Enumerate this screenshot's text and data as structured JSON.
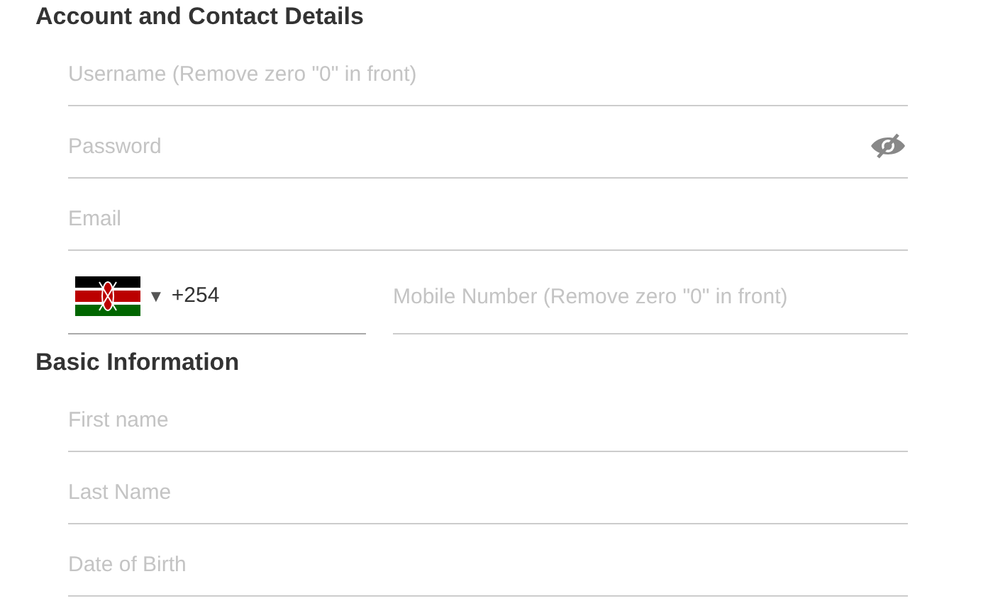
{
  "sections": [
    {
      "title": "Account and Contact Details",
      "fields": [
        {
          "kind": "text",
          "placeholder": "Username (Remove zero \"0\" in front)"
        },
        {
          "kind": "password",
          "placeholder": "Password"
        },
        {
          "kind": "text",
          "placeholder": "Email"
        },
        {
          "kind": "phone",
          "caret": "▼",
          "code": "+254",
          "placeholder": "Mobile Number (Remove zero \"0\" in front)"
        }
      ]
    },
    {
      "title": "Basic Information",
      "fields": [
        {
          "kind": "text",
          "placeholder": "First name"
        },
        {
          "kind": "text",
          "placeholder": "Last Name"
        },
        {
          "kind": "text",
          "placeholder": "Date of Birth"
        }
      ]
    }
  ]
}
